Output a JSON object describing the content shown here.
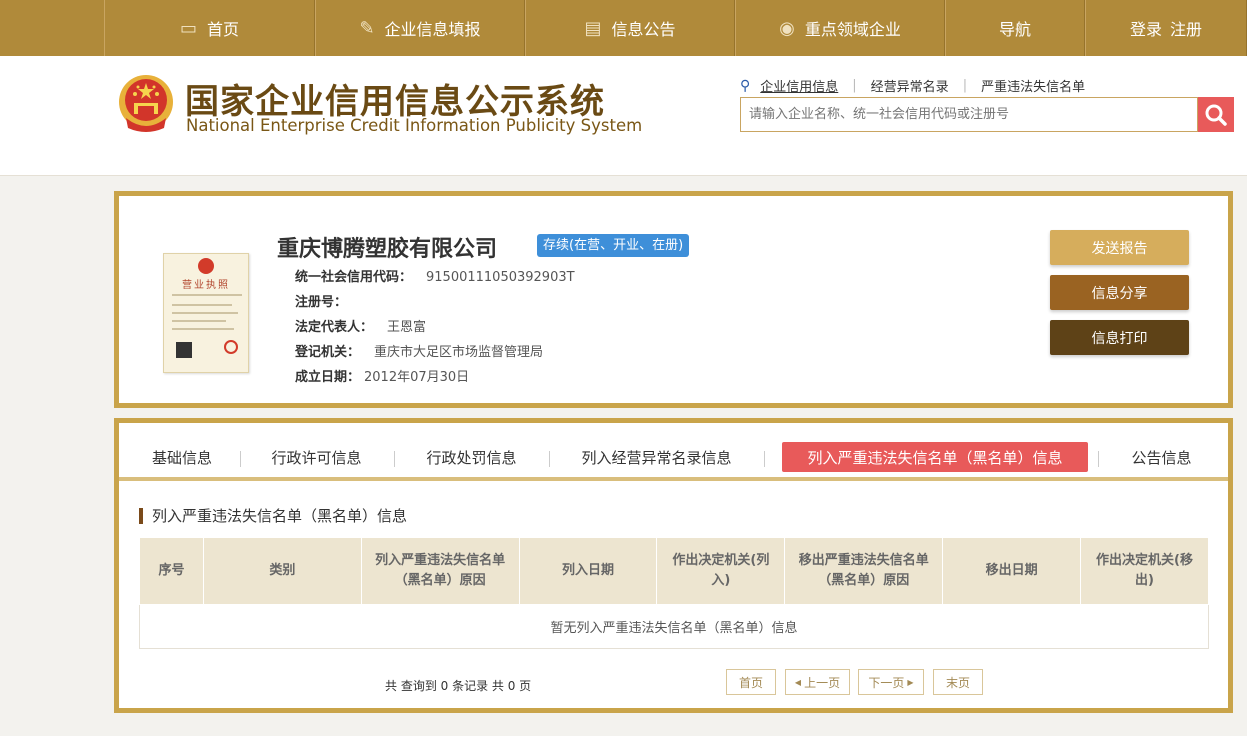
{
  "nav": {
    "items": [
      {
        "label": "首页",
        "icon": "monitor-icon"
      },
      {
        "label": "企业信息填报",
        "icon": "pen-icon"
      },
      {
        "label": "信息公告",
        "icon": "document-icon"
      },
      {
        "label": "重点领域企业",
        "icon": "speaker-icon"
      },
      {
        "label": "导航",
        "icon": ""
      }
    ],
    "login": "登录",
    "register": "注册"
  },
  "header": {
    "title_cn": "国家企业信用信息公示系统",
    "title_en": "National Enterprise Credit Information Publicity System"
  },
  "search": {
    "tabs": [
      "企业信用信息",
      "经营异常名录",
      "严重违法失信名单"
    ],
    "active_tab": 0,
    "placeholder": "请输入企业名称、统一社会信用代码或注册号",
    "button_color": "#e85a5a"
  },
  "company": {
    "name": "重庆博腾塑胶有限公司",
    "status": "存续(在营、开业、在册)",
    "license_title": "营业执照",
    "fields": [
      {
        "label": "统一社会信用代码：",
        "value": "91500111050392903T"
      },
      {
        "label": "注册号：",
        "value": ""
      },
      {
        "label": "法定代表人：",
        "value": "王恩富"
      },
      {
        "label": "登记机关：",
        "value": "重庆市大足区市场监督管理局"
      },
      {
        "label": "成立日期：",
        "value": "2012年07月30日"
      }
    ]
  },
  "actions": {
    "send_report": "发送报告",
    "share": "信息分享",
    "print": "信息打印"
  },
  "tabs": {
    "items": [
      "基础信息",
      "行政许可信息",
      "行政处罚信息",
      "列入经营异常名录信息",
      "列入严重违法失信名单（黑名单）信息",
      "公告信息"
    ],
    "active": 4
  },
  "section": {
    "title": "列入严重违法失信名单（黑名单）信息",
    "columns": [
      "序号",
      "类别",
      "列入严重违法失信名单（黑名单）原因",
      "列入日期",
      "作出决定机关(列入)",
      "移出严重违法失信名单（黑名单）原因",
      "移出日期",
      "作出决定机关(移出)"
    ],
    "empty_text": "暂无列入严重违法失信名单（黑名单）信息"
  },
  "pager": {
    "info": "共 查询到 0 条记录 共 0 页",
    "first": "首页",
    "prev": "上一页",
    "next": "下一页",
    "last": "末页"
  },
  "colors": {
    "nav_bg": "#b08a3a",
    "accent_red": "#e85a5a",
    "status_blue": "#3e8fd9",
    "border_gold": "#c9a44a"
  }
}
